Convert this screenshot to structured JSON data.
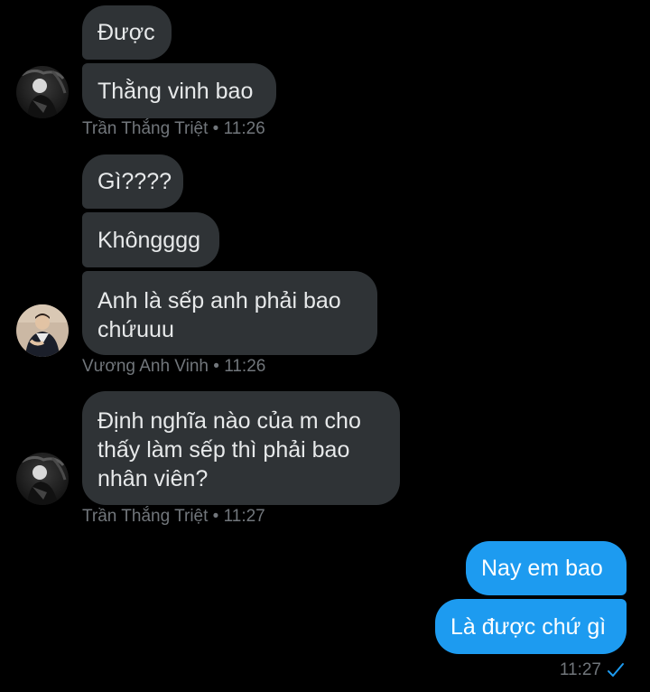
{
  "messages": [
    {
      "text": "Được"
    },
    {
      "text": "Thằng vinh bao"
    },
    {
      "text": "Gì????"
    },
    {
      "text": "Khôngggg"
    },
    {
      "text": "Anh là sếp anh phải bao chứuuu"
    },
    {
      "text": "Định nghĩa nào của m cho thấy làm sếp thì phải bao nhân viên?"
    },
    {
      "text": "Nay em bao"
    },
    {
      "text": "Là được chứ gì"
    }
  ],
  "meta": {
    "group1": "Trần Thắng Triệt • 11:26",
    "group2": "Vương Anh Vinh • 11:26",
    "group3": "Trần Thắng Triệt • 11:27",
    "outgoing_time": "11:27"
  },
  "icons": {
    "read_receipt": "check-icon",
    "avatar_triet": "avatar-icon",
    "avatar_vinh": "avatar-icon"
  },
  "colors": {
    "background": "#000000",
    "incoming_bubble": "#2f3336",
    "outgoing_bubble": "#1d9bf0",
    "meta_text": "#71767b"
  }
}
